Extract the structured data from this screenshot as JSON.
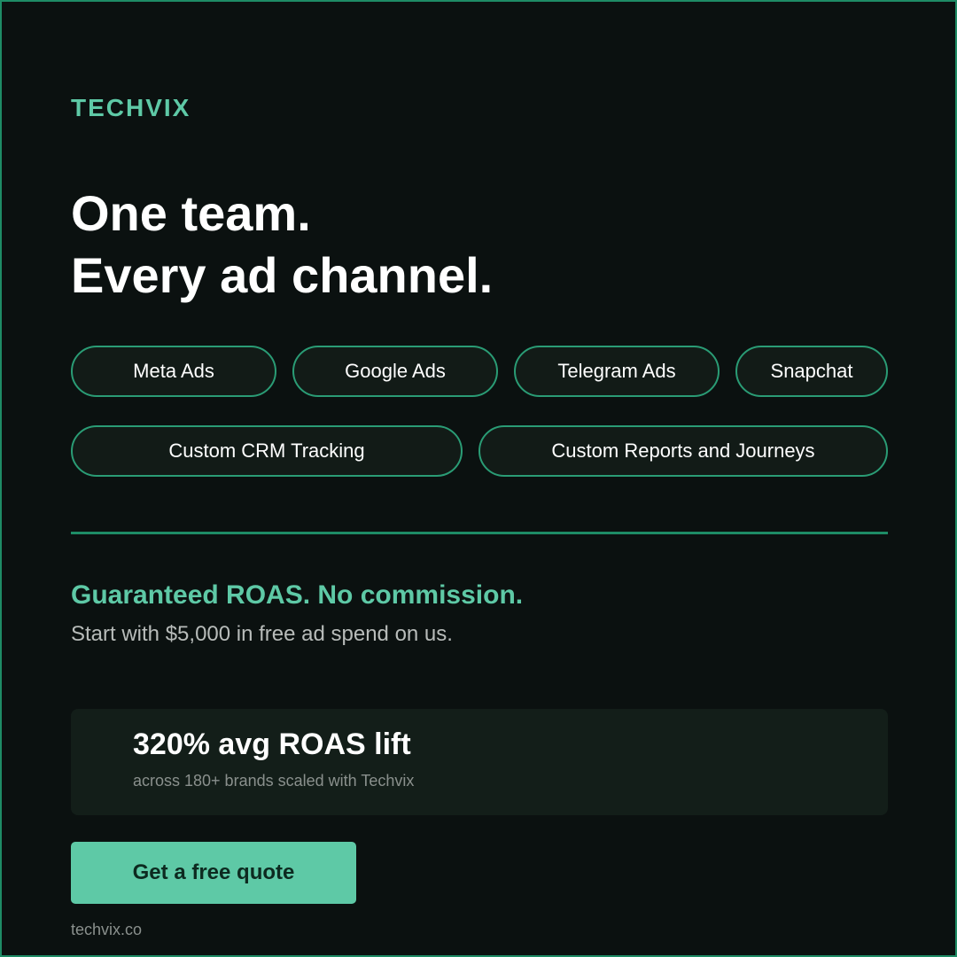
{
  "brand": {
    "name": "TECHVIX"
  },
  "hero": {
    "line1": "One team.",
    "line2": "Every ad channel."
  },
  "channels": [
    {
      "label": "Meta Ads"
    },
    {
      "label": "Google Ads"
    },
    {
      "label": "Telegram Ads"
    },
    {
      "label": "Snapchat"
    },
    {
      "label": "Custom CRM Tracking"
    },
    {
      "label": "Custom Reports and Journeys"
    }
  ],
  "offer": {
    "title": "Guaranteed ROAS. No commission.",
    "subtitle": "Start with $5,000 in free ad spend on us."
  },
  "stat": {
    "value": "320% avg ROAS lift",
    "note": "across 180+ brands scaled with Techvix"
  },
  "cta": {
    "label": "Get a free quote"
  },
  "footer": {
    "website": "techvix.co"
  },
  "colors": {
    "background": "#0b1110",
    "accent": "#5ec9a6",
    "border": "#1e8c66",
    "card": "#131e19",
    "cta_text": "#0d2a20"
  }
}
